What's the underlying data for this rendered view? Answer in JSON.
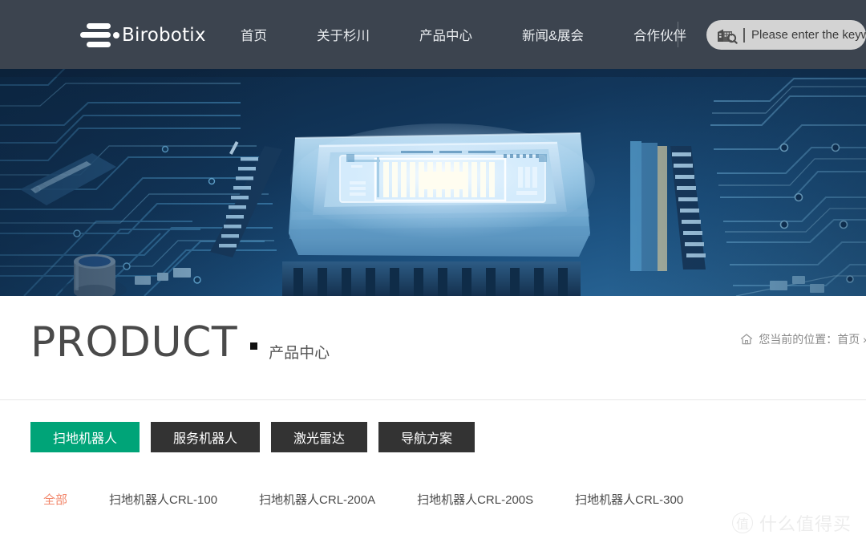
{
  "header": {
    "logo_text": "Birobotix",
    "logo_icon": "three-bars-dot-logo",
    "nav": [
      {
        "label": "首页"
      },
      {
        "label": "关于杉川"
      },
      {
        "label": "产品中心"
      },
      {
        "label": "新闻&展会"
      },
      {
        "label": "合作伙伴"
      }
    ],
    "search": {
      "icon": "building-search-icon",
      "placeholder": "Please enter the keyword",
      "value": ""
    },
    "bg_color": "#3c444f"
  },
  "banner": {
    "alt": "circuit-board-chip-banner",
    "bg_color": "#0d2138"
  },
  "title": {
    "english": "PRODUCT",
    "bullet": "■",
    "chinese": "产品中心"
  },
  "breadcrumb": {
    "icon": "home-icon",
    "text": "您当前的位置：首页 »"
  },
  "tabs": [
    {
      "label": "扫地机器人",
      "active": true
    },
    {
      "label": "服务机器人",
      "active": false
    },
    {
      "label": "激光雷达",
      "active": false
    },
    {
      "label": "导航方案",
      "active": false
    }
  ],
  "subfilters": [
    {
      "label": "全部",
      "active": true
    },
    {
      "label": "扫地机器人CRL-100",
      "active": false
    },
    {
      "label": "扫地机器人CRL-200A",
      "active": false
    },
    {
      "label": "扫地机器人CRL-200S",
      "active": false
    },
    {
      "label": "扫地机器人CRL-300",
      "active": false
    }
  ],
  "watermark": {
    "badge": "值",
    "text": "什么值得买"
  },
  "colors": {
    "accent_green": "#00a478",
    "accent_orange": "#f2866a",
    "tab_dark": "#333333",
    "header_bg": "#3c444f"
  }
}
